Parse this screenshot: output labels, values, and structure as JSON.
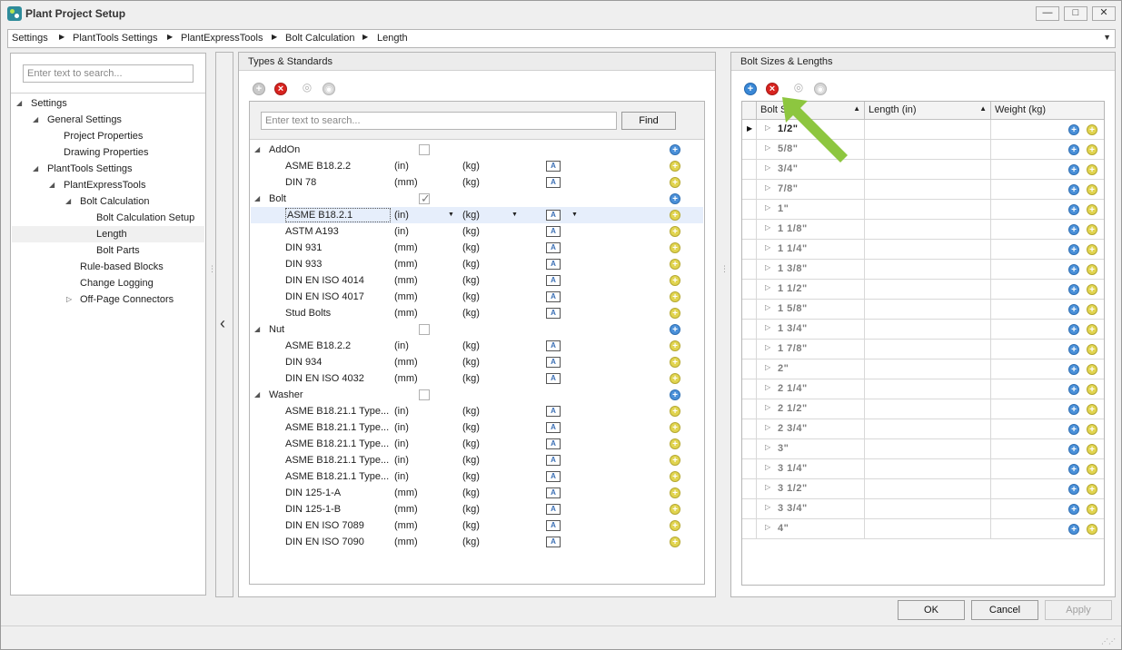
{
  "window": {
    "title": "Plant Project Setup",
    "controls": [
      "—",
      "□",
      "✕"
    ]
  },
  "breadcrumb": {
    "items": [
      "Settings",
      "PlantTools Settings",
      "PlantExpressTools",
      "Bolt Calculation",
      "Length"
    ]
  },
  "nav": {
    "search_placeholder": "Enter text to search...",
    "items": [
      "Settings",
      "General Settings",
      "Project Properties",
      "Drawing Properties",
      "PlantTools Settings",
      "PlantExpressTools",
      "Bolt Calculation",
      "Bolt Calculation Setup",
      "Length",
      "Bolt Parts",
      "Rule-based Blocks",
      "Change Logging",
      "Off-Page Connectors"
    ]
  },
  "types": {
    "title": "Types & Standards",
    "search_placeholder": "Enter text to search...",
    "find_label": "Find",
    "groups": [
      {
        "name": "AddOn",
        "rows": [
          [
            "ASME B18.2.2",
            "(in)",
            "(kg)"
          ],
          [
            "DIN 78",
            "(mm)",
            "(kg)"
          ]
        ]
      },
      {
        "name": "Bolt",
        "rows": [
          [
            "ASME B18.2.1",
            "(in)",
            "(kg)"
          ],
          [
            "ASTM A193",
            "(in)",
            "(kg)"
          ],
          [
            "DIN 931",
            "(mm)",
            "(kg)"
          ],
          [
            "DIN 933",
            "(mm)",
            "(kg)"
          ],
          [
            "DIN EN ISO 4014",
            "(mm)",
            "(kg)"
          ],
          [
            "DIN EN ISO 4017",
            "(mm)",
            "(kg)"
          ],
          [
            "Stud Bolts",
            "(mm)",
            "(kg)"
          ]
        ]
      },
      {
        "name": "Nut",
        "rows": [
          [
            "ASME B18.2.2",
            "(in)",
            "(kg)"
          ],
          [
            "DIN 934",
            "(mm)",
            "(kg)"
          ],
          [
            "DIN EN ISO 4032",
            "(mm)",
            "(kg)"
          ]
        ]
      },
      {
        "name": "Washer",
        "rows": [
          [
            "ASME B18.21.1 Type...",
            "(in)",
            "(kg)"
          ],
          [
            "ASME B18.21.1 Type...",
            "(in)",
            "(kg)"
          ],
          [
            "ASME B18.21.1 Type...",
            "(in)",
            "(kg)"
          ],
          [
            "ASME B18.21.1 Type...",
            "(in)",
            "(kg)"
          ],
          [
            "ASME B18.21.1 Type...",
            "(in)",
            "(kg)"
          ],
          [
            "DIN 125-1-A",
            "(mm)",
            "(kg)"
          ],
          [
            "DIN 125-1-B",
            "(mm)",
            "(kg)"
          ],
          [
            "DIN EN ISO 7089",
            "(mm)",
            "(kg)"
          ],
          [
            "DIN EN ISO 7090",
            "(mm)",
            "(kg)"
          ]
        ]
      }
    ]
  },
  "bolt_sizes": {
    "title": "Bolt Sizes & Lengths",
    "columns": [
      "Bolt Size",
      "Length (in)",
      "Weight (kg)"
    ],
    "sizes": [
      "1/2\"",
      "5/8\"",
      "3/4\"",
      "7/8\"",
      "1\"",
      "1 1/8\"",
      "1 1/4\"",
      "1 3/8\"",
      "1 1/2\"",
      "1 5/8\"",
      "1 3/4\"",
      "1 7/8\"",
      "2\"",
      "2 1/4\"",
      "2 1/2\"",
      "2 3/4\"",
      "3\"",
      "3 1/4\"",
      "3 1/2\"",
      "3 3/4\"",
      "4\""
    ]
  },
  "footer": {
    "ok": "OK",
    "cancel": "Cancel",
    "apply": "Apply"
  },
  "colors": {
    "accent": "#8dc63f",
    "selection": "#e6eefb",
    "delete": "#d8231f",
    "add": "#3a88d6"
  }
}
